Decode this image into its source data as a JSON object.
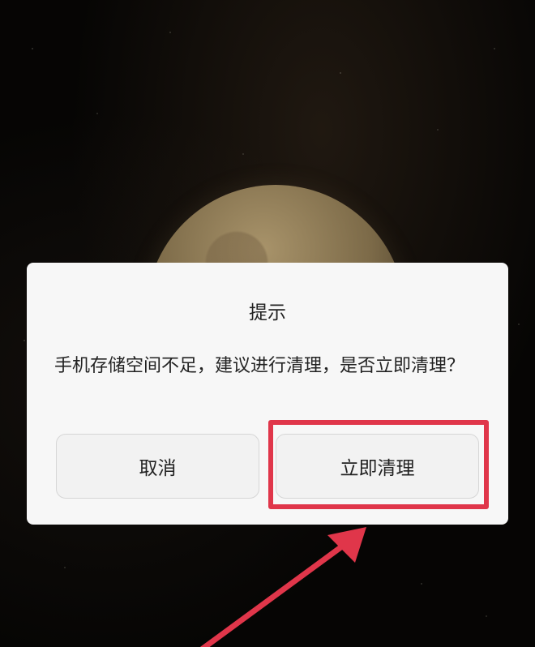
{
  "dialog": {
    "title": "提示",
    "message": "手机存储空间不足，建议进行清理，是否立即清理？",
    "cancel_label": "取消",
    "confirm_label": "立即清理"
  },
  "annotation": {
    "color": "#e0364a"
  }
}
